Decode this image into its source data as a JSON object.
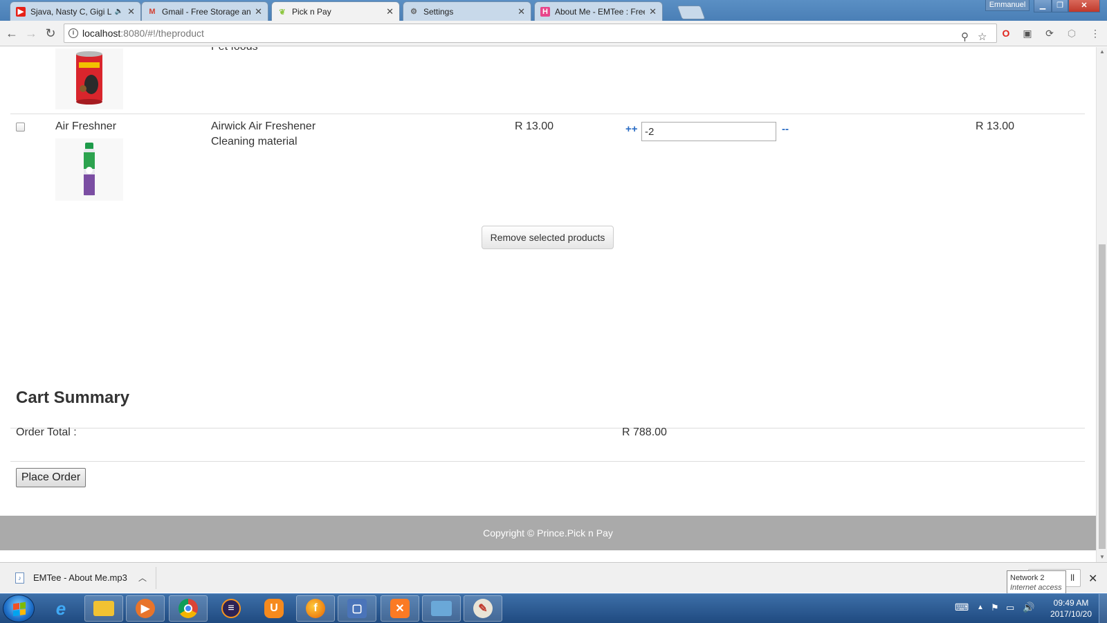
{
  "browser": {
    "tabs": [
      {
        "title": "Sjava, Nasty C, Gigi La",
        "icon": "youtube-icon",
        "muted": true
      },
      {
        "title": "Gmail - Free Storage and",
        "icon": "gmail-icon"
      },
      {
        "title": "Pick n Pay",
        "icon": "leaf-icon",
        "active": true
      },
      {
        "title": "Settings",
        "icon": "gear-icon"
      },
      {
        "title": "About Me - EMTee : Free",
        "icon": "h-icon"
      }
    ],
    "profile_name": "Emmanuel",
    "url_host": "localhost",
    "url_path": ":8080/#!/theproduct"
  },
  "cart": {
    "rows": [
      {
        "category": "",
        "name": "",
        "category_label": "Pet foods",
        "image": "husky-can",
        "price": "",
        "quantity": "",
        "subtotal": ""
      },
      {
        "category": "Air Freshner",
        "name": "Airwick Air Freshener",
        "category_label": "Cleaning material",
        "image": "airwick-can",
        "price": "R 13.00",
        "quantity": "-2",
        "increment_label": "++",
        "decrement_label": "--",
        "subtotal": "R 13.00"
      }
    ],
    "remove_button_label": "Remove selected products"
  },
  "summary": {
    "title": "Cart Summary",
    "order_total_label": "Order Total :",
    "order_total_value": "R 788.00",
    "place_order_label": "Place Order"
  },
  "footer": {
    "copyright": "Copyright © Prince.Pick n Pay"
  },
  "downloads": {
    "file_name": "EMTee - About Me.mp3",
    "tooltip_title": "Network  2",
    "tooltip_sub": "Internet access",
    "show_all_label": "ll"
  },
  "taskbar": {
    "time": "09:49 AM",
    "date": "2017/10/20"
  },
  "colors": {
    "link_blue": "#2a6cc4",
    "footer_gray": "#aaaaaa",
    "taskbar_blue": "#1f4a80"
  }
}
